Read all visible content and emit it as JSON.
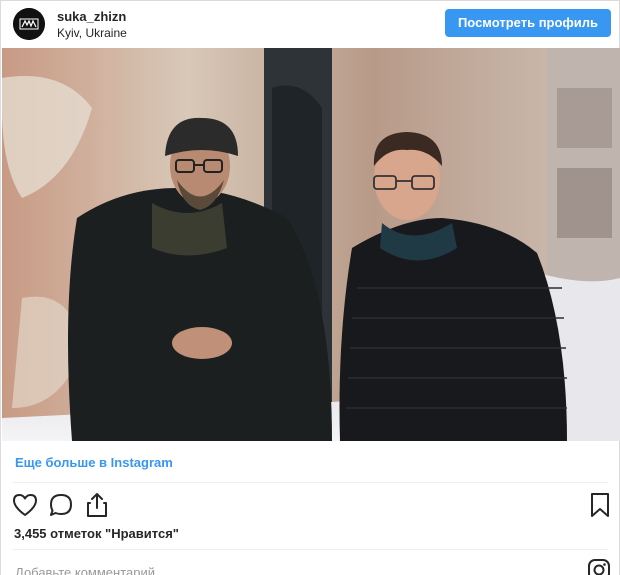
{
  "header": {
    "username": "suka_zhizn",
    "location": "Kyiv, Ukraine",
    "view_profile_label": "Посмотреть профиль"
  },
  "colors": {
    "accent": "#3897f0",
    "text": "#262626",
    "placeholder": "#999999",
    "border": "#dbdbdb"
  },
  "photo": {
    "description_icon": "photo"
  },
  "more_link": "Еще больше в Instagram",
  "actions": {
    "icons": [
      "heart-icon",
      "comment-icon",
      "share-icon",
      "bookmark-icon"
    ]
  },
  "likes_text": "3,455 отметок \"Нравится\"",
  "comment_placeholder": "Добавьте комментарий..."
}
